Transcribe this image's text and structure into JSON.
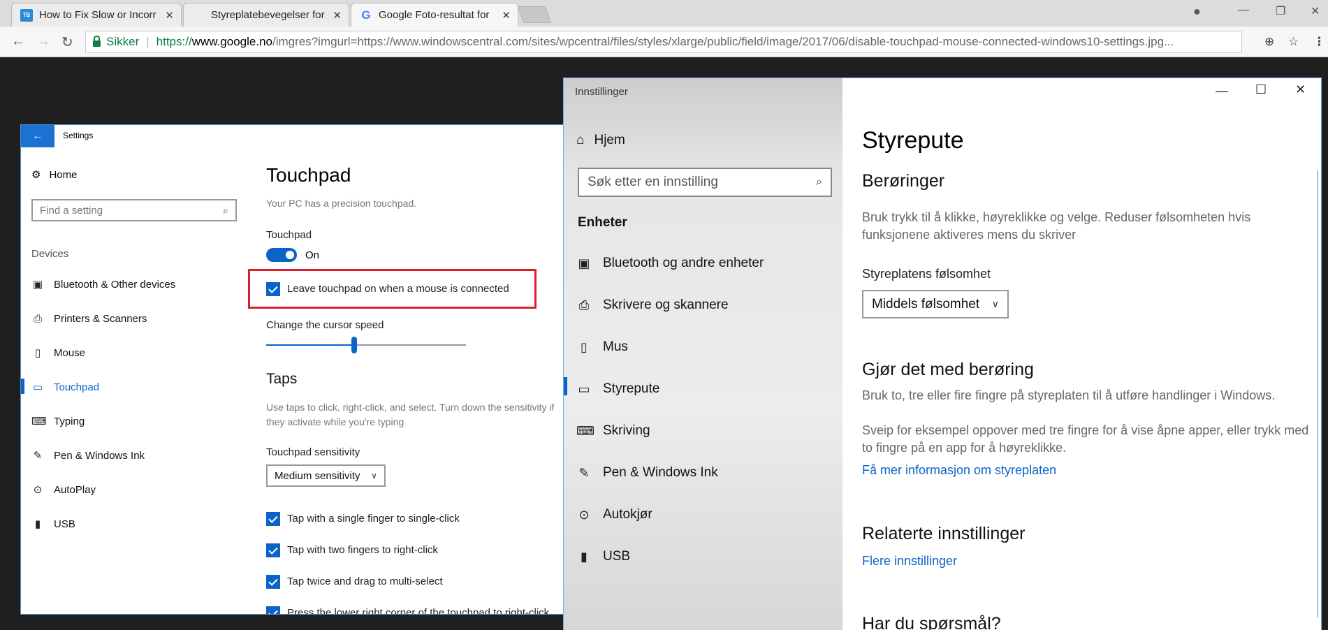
{
  "browser": {
    "tabs": [
      {
        "title": "How to Fix Slow or Incorr",
        "favicon": "TB"
      },
      {
        "title": "Styreplatebevegelser for",
        "favicon": "ms"
      },
      {
        "title": "Google Foto-resultat for",
        "favicon": "G"
      }
    ],
    "close_glyph": "✕",
    "secure_label": "Sikker",
    "url_scheme": "https://",
    "url_host": "www.google.no",
    "url_rest": "/imgres?imgurl=https://www.windowscentral.com/sites/wpcentral/files/styles/xlarge/public/field/image/2017/06/disable-touchpad-mouse-connected-windows10-settings.jpg..."
  },
  "left_window": {
    "title": "Settings",
    "home": "Home",
    "search_placeholder": "Find a setting",
    "group": "Devices",
    "nav": [
      {
        "label": "Bluetooth & Other devices",
        "icon": "bluetooth-device-icon"
      },
      {
        "label": "Printers & Scanners",
        "icon": "printer-icon"
      },
      {
        "label": "Mouse",
        "icon": "mouse-icon"
      },
      {
        "label": "Touchpad",
        "icon": "touchpad-icon"
      },
      {
        "label": "Typing",
        "icon": "keyboard-icon"
      },
      {
        "label": "Pen & Windows Ink",
        "icon": "pen-icon"
      },
      {
        "label": "AutoPlay",
        "icon": "autoplay-icon"
      },
      {
        "label": "USB",
        "icon": "usb-icon"
      }
    ],
    "page_title": "Touchpad",
    "subtitle": "Your PC has a precision touchpad.",
    "touchpad_label": "Touchpad",
    "toggle_state": "On",
    "leave_on_label": "Leave touchpad on when a mouse is connected",
    "cursor_speed_label": "Change the cursor speed",
    "cursor_speed_value": 0.44,
    "taps_heading": "Taps",
    "taps_desc": "Use taps to click, right-click, and select. Turn down the sensitivity if they activate while you're typing",
    "sensitivity_label": "Touchpad sensitivity",
    "sensitivity_value": "Medium sensitivity",
    "tap_options": [
      "Tap with a single finger to single-click",
      "Tap with two fingers to right-click",
      "Tap twice and drag to multi-select",
      "Press the lower right corner of the touchpad to right-click"
    ],
    "accent": "#0a64c8",
    "highlight_color": "#d9202b"
  },
  "right_window": {
    "app_title": "Innstillinger",
    "home": "Hjem",
    "search_placeholder": "Søk etter en innstilling",
    "group": "Enheter",
    "nav": [
      {
        "label": "Bluetooth og andre enheter",
        "icon": "bluetooth-device-icon"
      },
      {
        "label": "Skrivere og skannere",
        "icon": "printer-icon"
      },
      {
        "label": "Mus",
        "icon": "mouse-icon"
      },
      {
        "label": "Styrepute",
        "icon": "touchpad-icon"
      },
      {
        "label": "Skriving",
        "icon": "keyboard-icon"
      },
      {
        "label": "Pen & Windows Ink",
        "icon": "pen-icon"
      },
      {
        "label": "Autokjør",
        "icon": "autoplay-icon"
      },
      {
        "label": "USB",
        "icon": "usb-icon"
      }
    ],
    "page_title": "Styrepute",
    "touches_heading": "Berøringer",
    "touches_desc": "Bruk trykk til å klikke, høyreklikke og velge. Reduser følsomheten hvis funksjonene aktiveres mens du skriver",
    "sensitivity_label": "Styreplatens følsomhet",
    "sensitivity_value": "Middels følsomhet",
    "gesture_heading": "Gjør det med berøring",
    "gesture_desc1": "Bruk to, tre eller fire fingre på styreplaten til å utføre handlinger i Windows.",
    "gesture_desc2": "Sveip for eksempel oppover med tre fingre for å vise åpne apper, eller trykk med to fingre på en app for å høyreklikke.",
    "gesture_link": "Få mer informasjon om styreplaten",
    "related_heading": "Relaterte innstillinger",
    "related_link": "Flere innstillinger",
    "questions_heading": "Har du spørsmål?"
  }
}
